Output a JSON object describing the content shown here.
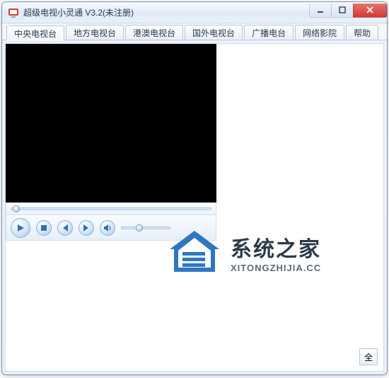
{
  "window": {
    "title": "超级电视小灵通 V3.2(未注册)"
  },
  "tabs": [
    {
      "label": "中央电视台",
      "active": true
    },
    {
      "label": "地方电视台",
      "active": false
    },
    {
      "label": "港澳电视台",
      "active": false
    },
    {
      "label": "国外电视台",
      "active": false
    },
    {
      "label": "广播电台",
      "active": false
    },
    {
      "label": "网络影院",
      "active": false
    },
    {
      "label": "帮助",
      "active": false
    }
  ],
  "watermark": {
    "cn": "系统之家",
    "en": "XITONGZHIJIA.CC"
  },
  "buttons": {
    "fullscreen": "全"
  },
  "icons": {
    "play": "play-icon",
    "stop": "stop-icon",
    "prev": "prev-icon",
    "next": "next-icon",
    "volume": "speaker-icon",
    "app": "app-icon"
  }
}
